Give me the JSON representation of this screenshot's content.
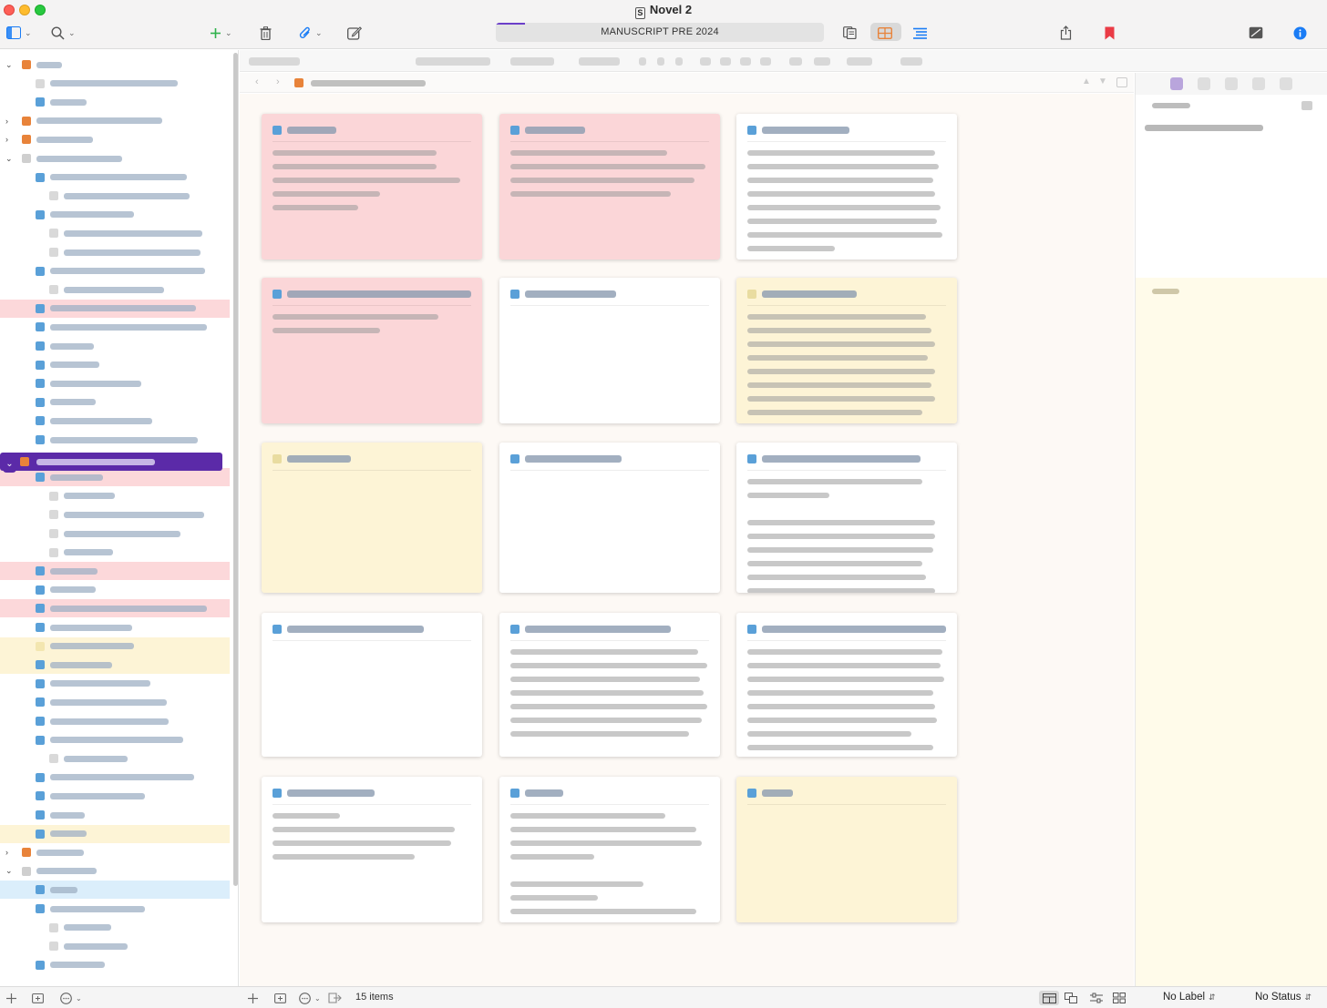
{
  "window": {
    "title": "Novel 2"
  },
  "toolbar": {
    "progress_title": "MANUSCRIPT PRE 2024",
    "progress_fraction": 0.09,
    "icons": [
      "sidebar-icon",
      "search-icon",
      "add-icon",
      "trash-icon",
      "attachment-icon",
      "compose-icon",
      "split-view-icon",
      "corkboard-icon",
      "outline-icon",
      "share-icon",
      "bookmark-icon",
      "quick-reference-icon",
      "inspector-icon"
    ],
    "accent_color": "#1a7cf5",
    "bookmark_color": "#ea3b45",
    "corkboard_color": "#e8833a",
    "add_color": "#2fb24c"
  },
  "footer": {
    "item_count": "15 items",
    "label_select": "No Label",
    "status_select": "No Status"
  },
  "card_colors": {
    "pink": "#fbd6d8",
    "yellow": "#fdf4d6",
    "white": "#ffffff"
  },
  "binder": {
    "selection_color": "#5b2aa8"
  }
}
